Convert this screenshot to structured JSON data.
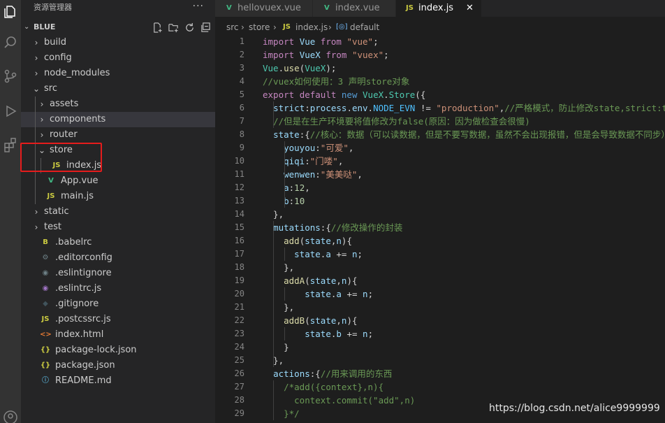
{
  "sidebar": {
    "title": "资源管理器",
    "more_label": "···",
    "project": {
      "name": "BLUE",
      "chevron": "⌄"
    },
    "actions": [
      "new-file-icon",
      "new-folder-icon",
      "refresh-icon",
      "collapse-all-icon"
    ],
    "tree": [
      {
        "label": "build",
        "twisty": "›",
        "icon": "folder"
      },
      {
        "label": "config",
        "twisty": "›",
        "icon": "folder"
      },
      {
        "label": "node_modules",
        "twisty": "›",
        "icon": "folder"
      },
      {
        "label": "src",
        "twisty": "⌄",
        "icon": "folder-open"
      },
      {
        "label": "assets",
        "twisty": "›",
        "icon": "folder"
      },
      {
        "label": "components",
        "twisty": "›",
        "icon": "folder",
        "selected": true
      },
      {
        "label": "router",
        "twisty": "›",
        "icon": "folder"
      },
      {
        "label": "store",
        "twisty": "⌄",
        "icon": "folder-open"
      },
      {
        "label": "index.js",
        "icon_text": "JS",
        "icon_color": "#cbcb41"
      },
      {
        "label": "App.vue",
        "icon_text": "V",
        "icon_color": "#41b883"
      },
      {
        "label": "main.js",
        "icon_text": "JS",
        "icon_color": "#cbcb41"
      },
      {
        "label": "static",
        "twisty": "›",
        "icon": "folder"
      },
      {
        "label": "test",
        "twisty": "›",
        "icon": "folder"
      },
      {
        "label": ".babelrc",
        "icon_text": "B",
        "icon_color": "#cbcb41"
      },
      {
        "label": ".editorconfig",
        "icon_text": "⚙",
        "icon_color": "#6d8086"
      },
      {
        "label": ".eslintignore",
        "icon_text": "◉",
        "icon_color": "#6d8086"
      },
      {
        "label": ".eslintrc.js",
        "icon_text": "◉",
        "icon_color": "#a074c4"
      },
      {
        "label": ".gitignore",
        "icon_text": "◆",
        "icon_color": "#41535b"
      },
      {
        "label": ".postcssrc.js",
        "icon_text": "JS",
        "icon_color": "#cbcb41"
      },
      {
        "label": "index.html",
        "icon_text": "<>",
        "icon_color": "#e37933"
      },
      {
        "label": "package-lock.json",
        "icon_text": "{}",
        "icon_color": "#cbcb41"
      },
      {
        "label": "package.json",
        "icon_text": "{}",
        "icon_color": "#cbcb41"
      },
      {
        "label": "README.md",
        "icon_text": "ⓘ",
        "icon_color": "#519aba"
      }
    ]
  },
  "tabs": [
    {
      "label": "hellovuex.vue",
      "icon_text": "V",
      "icon_color": "#41b883"
    },
    {
      "label": "index.vue",
      "icon_text": "V",
      "icon_color": "#41b883"
    },
    {
      "label": "index.js",
      "icon_text": "JS",
      "icon_color": "#cbcb41",
      "active": true,
      "close": "✕"
    }
  ],
  "breadcrumb": {
    "parts": [
      "src",
      "store",
      "index.js",
      "default"
    ],
    "sep": "›",
    "js_icon": "JS",
    "symbol_icon": "[◎]"
  },
  "editor": {
    "lines": [
      [
        [
          "kw",
          "import"
        ],
        [
          "pun",
          " "
        ],
        [
          "prop",
          "Vue"
        ],
        [
          "pun",
          " "
        ],
        [
          "kw",
          "from"
        ],
        [
          "pun",
          " "
        ],
        [
          "str",
          "\"vue\""
        ],
        [
          "pun",
          ";"
        ]
      ],
      [
        [
          "kw",
          "import"
        ],
        [
          "pun",
          " "
        ],
        [
          "prop",
          "VueX"
        ],
        [
          "pun",
          " "
        ],
        [
          "kw",
          "from"
        ],
        [
          "pun",
          " "
        ],
        [
          "str",
          "\"vuex\""
        ],
        [
          "pun",
          ";"
        ]
      ],
      [
        [
          "cls",
          "Vue"
        ],
        [
          "pun",
          "."
        ],
        [
          "fn",
          "use"
        ],
        [
          "pun",
          "("
        ],
        [
          "cls",
          "VueX"
        ],
        [
          "pun",
          ");"
        ]
      ],
      [
        [
          "cmt",
          "//vuex如何使用：3 声明store对象"
        ]
      ],
      [
        [
          "kw",
          "export"
        ],
        [
          "pun",
          " "
        ],
        [
          "kw",
          "default"
        ],
        [
          "pun",
          " "
        ],
        [
          "kwb",
          "new"
        ],
        [
          "pun",
          " "
        ],
        [
          "cls",
          "VueX"
        ],
        [
          "pun",
          "."
        ],
        [
          "cls",
          "Store"
        ],
        [
          "pun",
          "({"
        ]
      ],
      [
        [
          "pun",
          "  "
        ],
        [
          "prop",
          "strict"
        ],
        [
          "pun",
          ":"
        ],
        [
          "prop",
          "process"
        ],
        [
          "pun",
          "."
        ],
        [
          "prop",
          "env"
        ],
        [
          "pun",
          "."
        ],
        [
          "cst",
          "NODE_EVN"
        ],
        [
          "pun",
          " != "
        ],
        [
          "str",
          "\"production\""
        ],
        [
          "pun",
          ","
        ],
        [
          "cmt",
          "//严格模式，防止修改state,strict:true"
        ]
      ],
      [
        [
          "pun",
          "  "
        ],
        [
          "cmt",
          "//但是在生产环境要将值修改为false(原因：因为做检查会很慢)"
        ]
      ],
      [
        [
          "pun",
          "  "
        ],
        [
          "prop",
          "state"
        ],
        [
          "pun",
          ":{"
        ],
        [
          "cmt",
          "//核心：数据（可以读数据，但是不要写数据，虽然不会出现报错，但是会导致数据不同步）"
        ]
      ],
      [
        [
          "pun",
          "    "
        ],
        [
          "prop",
          "youyou"
        ],
        [
          "pun",
          ":"
        ],
        [
          "str",
          "\"可爱\""
        ],
        [
          "pun",
          ","
        ]
      ],
      [
        [
          "pun",
          "    "
        ],
        [
          "prop",
          "qiqi"
        ],
        [
          "pun",
          ":"
        ],
        [
          "str",
          "\"门喽\""
        ],
        [
          "pun",
          ","
        ]
      ],
      [
        [
          "pun",
          "    "
        ],
        [
          "prop",
          "wenwen"
        ],
        [
          "pun",
          ":"
        ],
        [
          "str",
          "\"美美哒\""
        ],
        [
          "pun",
          ","
        ]
      ],
      [
        [
          "pun",
          "    "
        ],
        [
          "prop",
          "a"
        ],
        [
          "pun",
          ":"
        ],
        [
          "num",
          "12"
        ],
        [
          "pun",
          ","
        ]
      ],
      [
        [
          "pun",
          "    "
        ],
        [
          "prop",
          "b"
        ],
        [
          "pun",
          ":"
        ],
        [
          "num",
          "10"
        ]
      ],
      [
        [
          "pun",
          "  },"
        ]
      ],
      [
        [
          "pun",
          "  "
        ],
        [
          "prop",
          "mutations"
        ],
        [
          "pun",
          ":{"
        ],
        [
          "cmt",
          "//修改操作的封装"
        ]
      ],
      [
        [
          "pun",
          "    "
        ],
        [
          "fn",
          "add"
        ],
        [
          "pun",
          "("
        ],
        [
          "prop",
          "state"
        ],
        [
          "pun",
          ","
        ],
        [
          "prop",
          "n"
        ],
        [
          "pun",
          "){"
        ]
      ],
      [
        [
          "pun",
          "      "
        ],
        [
          "prop",
          "state"
        ],
        [
          "pun",
          "."
        ],
        [
          "prop",
          "a"
        ],
        [
          "pun",
          " += "
        ],
        [
          "prop",
          "n"
        ],
        [
          "pun",
          ";"
        ]
      ],
      [
        [
          "pun",
          "    },"
        ]
      ],
      [
        [
          "pun",
          "    "
        ],
        [
          "fn",
          "addA"
        ],
        [
          "pun",
          "("
        ],
        [
          "prop",
          "state"
        ],
        [
          "pun",
          ","
        ],
        [
          "prop",
          "n"
        ],
        [
          "pun",
          "){"
        ]
      ],
      [
        [
          "pun",
          "        "
        ],
        [
          "prop",
          "state"
        ],
        [
          "pun",
          "."
        ],
        [
          "prop",
          "a"
        ],
        [
          "pun",
          " += "
        ],
        [
          "prop",
          "n"
        ],
        [
          "pun",
          ";"
        ]
      ],
      [
        [
          "pun",
          "    },"
        ]
      ],
      [
        [
          "pun",
          "    "
        ],
        [
          "fn",
          "addB"
        ],
        [
          "pun",
          "("
        ],
        [
          "prop",
          "state"
        ],
        [
          "pun",
          ","
        ],
        [
          "prop",
          "n"
        ],
        [
          "pun",
          "){"
        ]
      ],
      [
        [
          "pun",
          "        "
        ],
        [
          "prop",
          "state"
        ],
        [
          "pun",
          "."
        ],
        [
          "prop",
          "b"
        ],
        [
          "pun",
          " += "
        ],
        [
          "prop",
          "n"
        ],
        [
          "pun",
          ";"
        ]
      ],
      [
        [
          "pun",
          "    }"
        ]
      ],
      [
        [
          "pun",
          "  },"
        ]
      ],
      [
        [
          "pun",
          "  "
        ],
        [
          "prop",
          "actions"
        ],
        [
          "pun",
          ":{"
        ],
        [
          "cmt",
          "//用来调用的东西"
        ]
      ],
      [
        [
          "pun",
          "    "
        ],
        [
          "cmt",
          "/*add({context},n){"
        ]
      ],
      [
        [
          "pun",
          "      "
        ],
        [
          "cmt",
          "context.commit(\"add\",n)"
        ]
      ],
      [
        [
          "pun",
          "    "
        ],
        [
          "cmt",
          "}*/"
        ]
      ]
    ],
    "line_numbers": [
      "1",
      "2",
      "3",
      "4",
      "5",
      "6",
      "7",
      "8",
      "9",
      "10",
      "11",
      "12",
      "13",
      "14",
      "15",
      "16",
      "17",
      "18",
      "19",
      "20",
      "21",
      "22",
      "23",
      "24",
      "25",
      "26",
      "27",
      "28",
      "29"
    ]
  },
  "watermark": "https://blog.csdn.net/alice9999999"
}
